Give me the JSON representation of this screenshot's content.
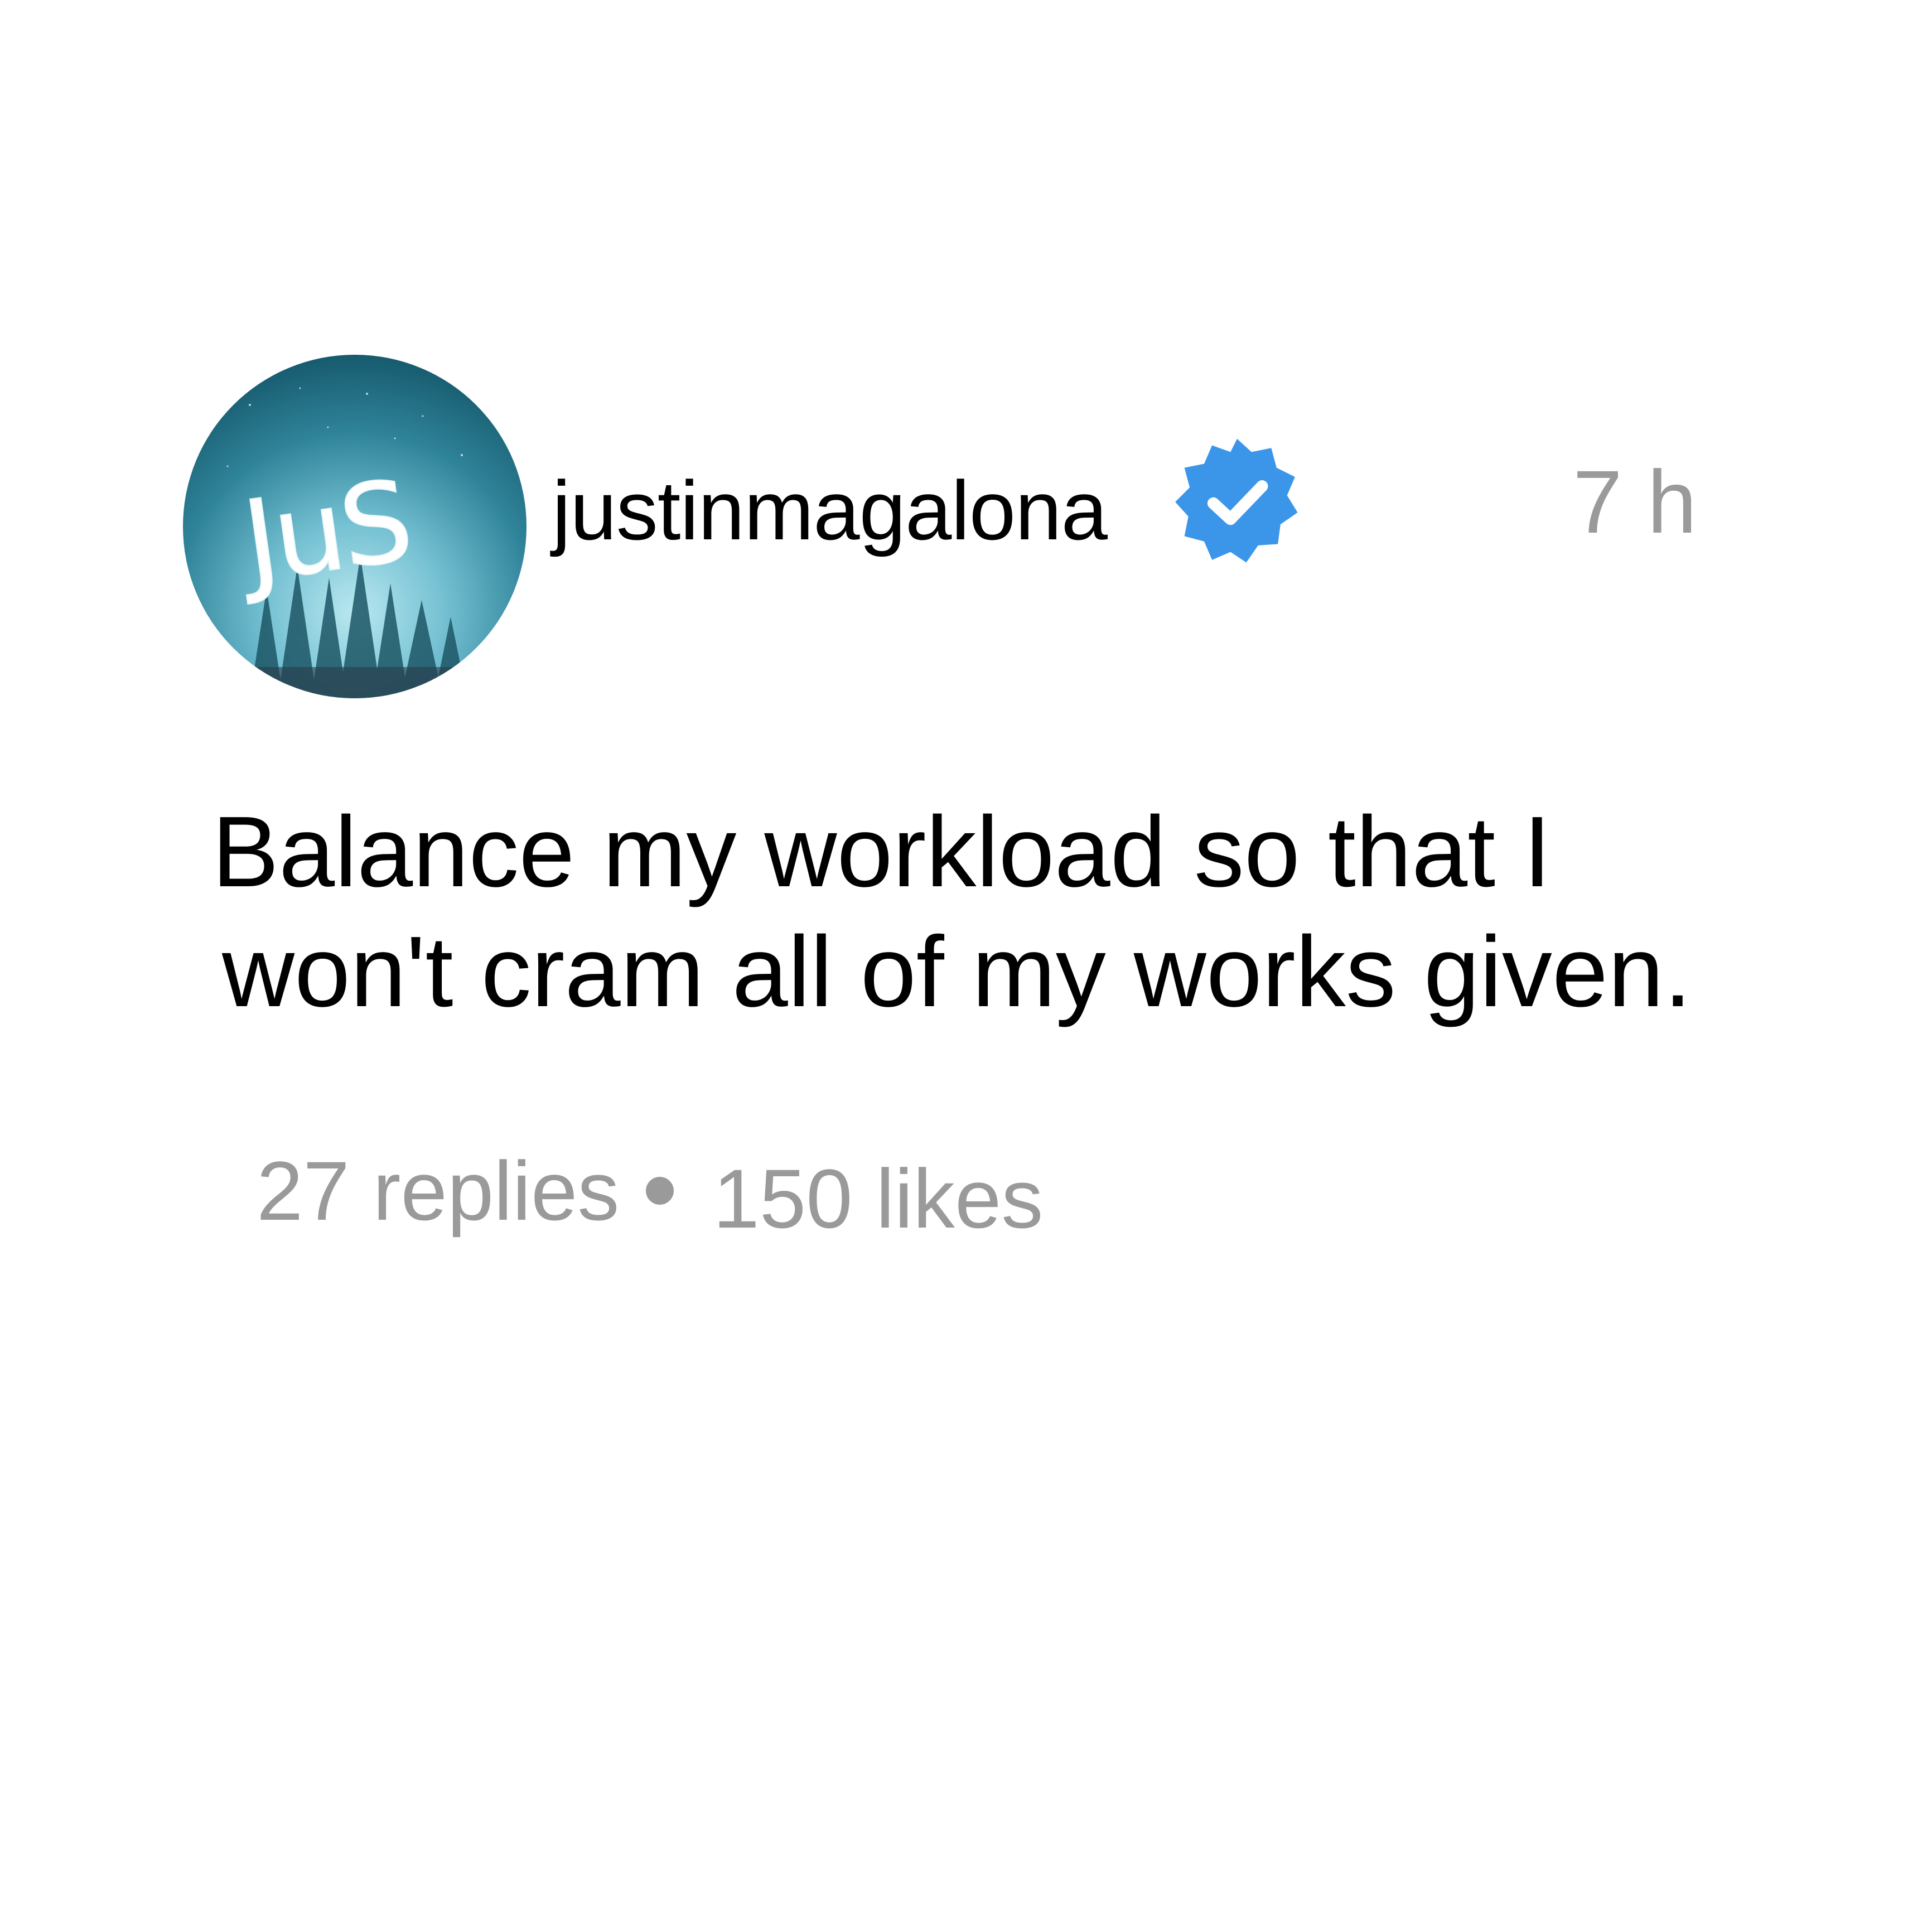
{
  "post": {
    "avatar": {
      "text": "JuS",
      "icon": "forest-night-avatar"
    },
    "username": "justinmagalona",
    "verified_icon": "verified-badge-icon",
    "timestamp": "7 h",
    "body": {
      "line1": "Balance my workload so that I",
      "line2": "won't cram all of my works given."
    },
    "stats": {
      "replies": "27 replies",
      "likes": "150 likes"
    }
  },
  "colors": {
    "verified": "#3b96ea",
    "muted_text": "#9a9a9a",
    "avatar_sky": "#1c6a80",
    "avatar_glow": "#a9dfea"
  }
}
